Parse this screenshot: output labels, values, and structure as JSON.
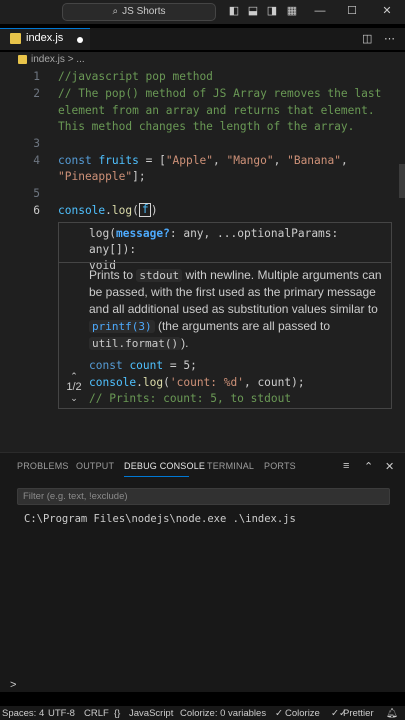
{
  "titlebar": {
    "command_center": "JS Shorts",
    "icons": [
      "toggle-sidebar-icon",
      "toggle-panel-icon",
      "toggle-secondary-sidebar-icon",
      "customize-layout-icon",
      "minimize-icon",
      "maximize-icon",
      "close-icon"
    ]
  },
  "tabs": [
    {
      "label": "index.js",
      "modified": true
    }
  ],
  "breadcrumb": {
    "file": "index.js",
    "rest": "> ..."
  },
  "editor": {
    "line_numbers": [
      "1",
      "2",
      "3",
      "4",
      "5",
      "6"
    ],
    "lines": {
      "l1": "//javascript pop method",
      "l2a": "// The pop() method of JS Array removes the last",
      "l2b": "element from an array and returns that element.",
      "l2c": "This method changes the length of the array.",
      "l4_kw": "const",
      "l4_var": "fruits",
      "l4_eq": " = [",
      "l4_s1": "\"Apple\"",
      "l4_c1": ", ",
      "l4_s2": "\"Mango\"",
      "l4_c2": ", ",
      "l4_s3": "\"Banana\"",
      "l4_c3": ",",
      "l4b_s4": "\"Pineapple\"",
      "l4b_end": "];",
      "l6_obj": "console",
      "l6_dot": ".",
      "l6_fn": "log",
      "l6_paren": "(",
      "l6_typed": "f",
      "l6_close": ")"
    }
  },
  "hover": {
    "sig_name": "log",
    "sig_open": "(",
    "sig_param": "message?",
    "sig_type1": ": any",
    "sig_rest": ", ...optionalParams: any[]):",
    "sig_ret": "void",
    "doc_1": "Prints to ",
    "doc_code1": "stdout",
    "doc_2": " with newline. Multiple arguments can be passed, with the first used as the primary message and all additional used as substitution values similar to ",
    "doc_code2": "printf(3)",
    "doc_3": " (the arguments are all passed to ",
    "doc_code3": "util.format()",
    "doc_4": ").",
    "ex_1_kw": "const",
    "ex_1_var": "count",
    "ex_1_rest": " = 5;",
    "ex_2_obj": "console",
    "ex_2_fn": "log",
    "ex_2_str": "'count: %d'",
    "ex_2_rest": ", count);",
    "ex_3": "// Prints: count: 5, to stdout",
    "pager": "1/2"
  },
  "panel": {
    "tabs": [
      "PROBLEMS",
      "OUTPUT",
      "DEBUG CONSOLE",
      "TERMINAL",
      "PORTS"
    ],
    "active_tab": "DEBUG CONSOLE",
    "filter_placeholder": "Filter (e.g. text, !exclude)",
    "console_output": "C:\\Program Files\\nodejs\\node.exe .\\index.js",
    "prompt": ">"
  },
  "statusbar": {
    "spaces": "Spaces: 4",
    "encoding": "UTF-8",
    "eol": "CRLF",
    "language": "JavaScript",
    "colorize": "Colorize: 0 variables",
    "colorize_toggle": "Colorize",
    "prettier": "Prettier"
  }
}
